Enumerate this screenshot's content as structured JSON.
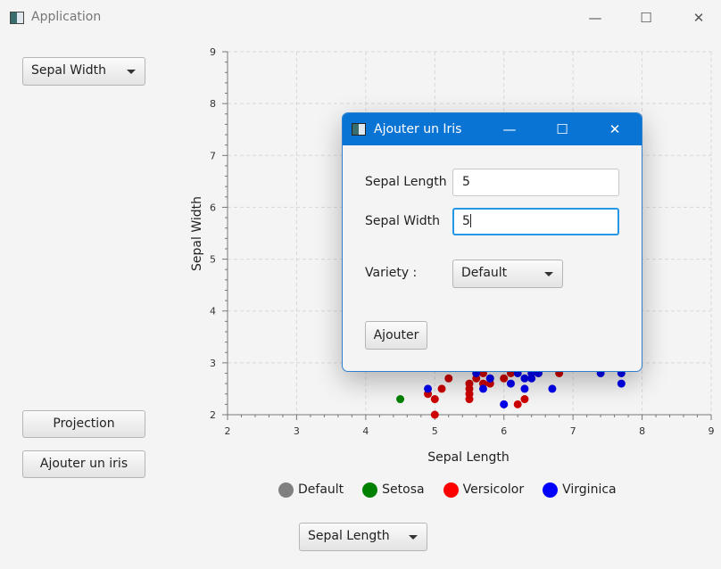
{
  "window": {
    "title": "Application",
    "controls": {
      "minimize": "—",
      "maximize": "☐",
      "close": "✕"
    }
  },
  "left_panel": {
    "y_axis_selector": {
      "selected": "Sepal Width"
    },
    "projection_button": "Projection",
    "add_iris_button": "Ajouter un iris"
  },
  "x_axis_selector": {
    "selected": "Sepal Length"
  },
  "legend": [
    {
      "label": "Default",
      "color": "#808080"
    },
    {
      "label": "Setosa",
      "color": "#008000"
    },
    {
      "label": "Versicolor",
      "color": "#ff0000"
    },
    {
      "label": "Virginica",
      "color": "#0000ff"
    }
  ],
  "chart_data": {
    "type": "scatter",
    "xlabel": "Sepal Length",
    "ylabel": "Sepal Width",
    "xlim": [
      2,
      9
    ],
    "ylim": [
      2,
      9
    ],
    "xticks": [
      2,
      3,
      4,
      5,
      6,
      7,
      8,
      9
    ],
    "yticks": [
      2,
      3,
      4,
      5,
      6,
      7,
      8,
      9
    ],
    "grid": true,
    "legend_position": "bottom",
    "series": [
      {
        "name": "Setosa",
        "color": "#008000",
        "points": [
          [
            4.5,
            2.3
          ]
        ]
      },
      {
        "name": "Versicolor",
        "color": "#cc0000",
        "points": [
          [
            4.9,
            2.4
          ],
          [
            5.0,
            2.3
          ],
          [
            5.0,
            2.0
          ],
          [
            5.1,
            2.5
          ],
          [
            5.2,
            2.7
          ],
          [
            5.5,
            2.3
          ],
          [
            5.5,
            2.4
          ],
          [
            5.5,
            2.5
          ],
          [
            5.5,
            2.6
          ],
          [
            5.6,
            2.7
          ],
          [
            5.7,
            2.6
          ],
          [
            5.7,
            2.8
          ],
          [
            5.8,
            2.7
          ],
          [
            5.8,
            2.6
          ],
          [
            6.0,
            2.7
          ],
          [
            6.0,
            2.2
          ],
          [
            6.1,
            2.8
          ],
          [
            6.2,
            2.2
          ],
          [
            6.2,
            2.9
          ],
          [
            6.3,
            2.3
          ],
          [
            6.4,
            2.9
          ],
          [
            6.5,
            2.8
          ],
          [
            6.6,
            2.9
          ],
          [
            6.8,
            2.8
          ]
        ]
      },
      {
        "name": "Virginica",
        "color": "#0000ee",
        "points": [
          [
            4.9,
            2.5
          ],
          [
            5.6,
            2.8
          ],
          [
            5.7,
            2.5
          ],
          [
            5.8,
            2.7
          ],
          [
            6.0,
            2.2
          ],
          [
            6.1,
            2.6
          ],
          [
            6.2,
            2.8
          ],
          [
            6.3,
            2.5
          ],
          [
            6.3,
            2.7
          ],
          [
            6.4,
            2.8
          ],
          [
            6.4,
            2.7
          ],
          [
            6.5,
            2.8
          ],
          [
            6.7,
            2.5
          ],
          [
            7.4,
            2.8
          ],
          [
            7.7,
            2.6
          ],
          [
            7.7,
            2.8
          ]
        ]
      }
    ]
  },
  "dialog": {
    "title": "Ajouter un Iris",
    "sepal_length": {
      "label": "Sepal Length",
      "value": "5"
    },
    "sepal_width": {
      "label": "Sepal Width",
      "value": "5"
    },
    "variety": {
      "label": "Variety :",
      "selected": "Default"
    },
    "submit_button": "Ajouter"
  }
}
